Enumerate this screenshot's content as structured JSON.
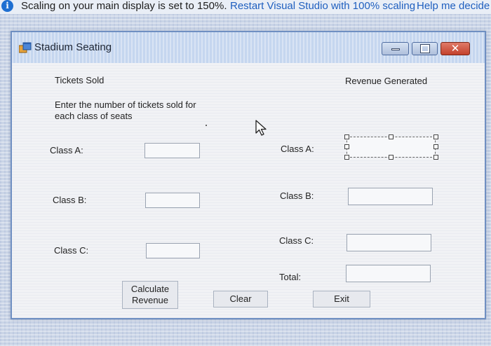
{
  "infobar": {
    "icon": "info-icon",
    "message": "Scaling on your main display is set to 150%.",
    "restart_link": "Restart Visual Studio with 100% scaling",
    "help_link": "Help me decide"
  },
  "window": {
    "title": "Stadium Seating",
    "icon": "app-form-icon",
    "controls": {
      "minimize": "minimize-icon",
      "maximize": "maximize-icon",
      "close": "✕"
    }
  },
  "form": {
    "tickets_header": "Tickets Sold",
    "revenue_header": "Revenue Generated",
    "instructions": "Enter the number of tickets sold for each class of seats",
    "inputs": {
      "class_a_label": "Class A:",
      "class_b_label": "Class B:",
      "class_c_label": "Class C:",
      "class_a_value": "",
      "class_b_value": "",
      "class_c_value": ""
    },
    "outputs": {
      "class_a_label": "Class A:",
      "class_b_label": "Class B:",
      "class_c_label": "Class C:",
      "total_label": "Total:",
      "class_a_value": "",
      "class_b_value": "",
      "class_c_value": "",
      "total_value": ""
    },
    "buttons": {
      "calculate": "Calculate Revenue",
      "clear": "Clear",
      "exit": "Exit"
    }
  }
}
